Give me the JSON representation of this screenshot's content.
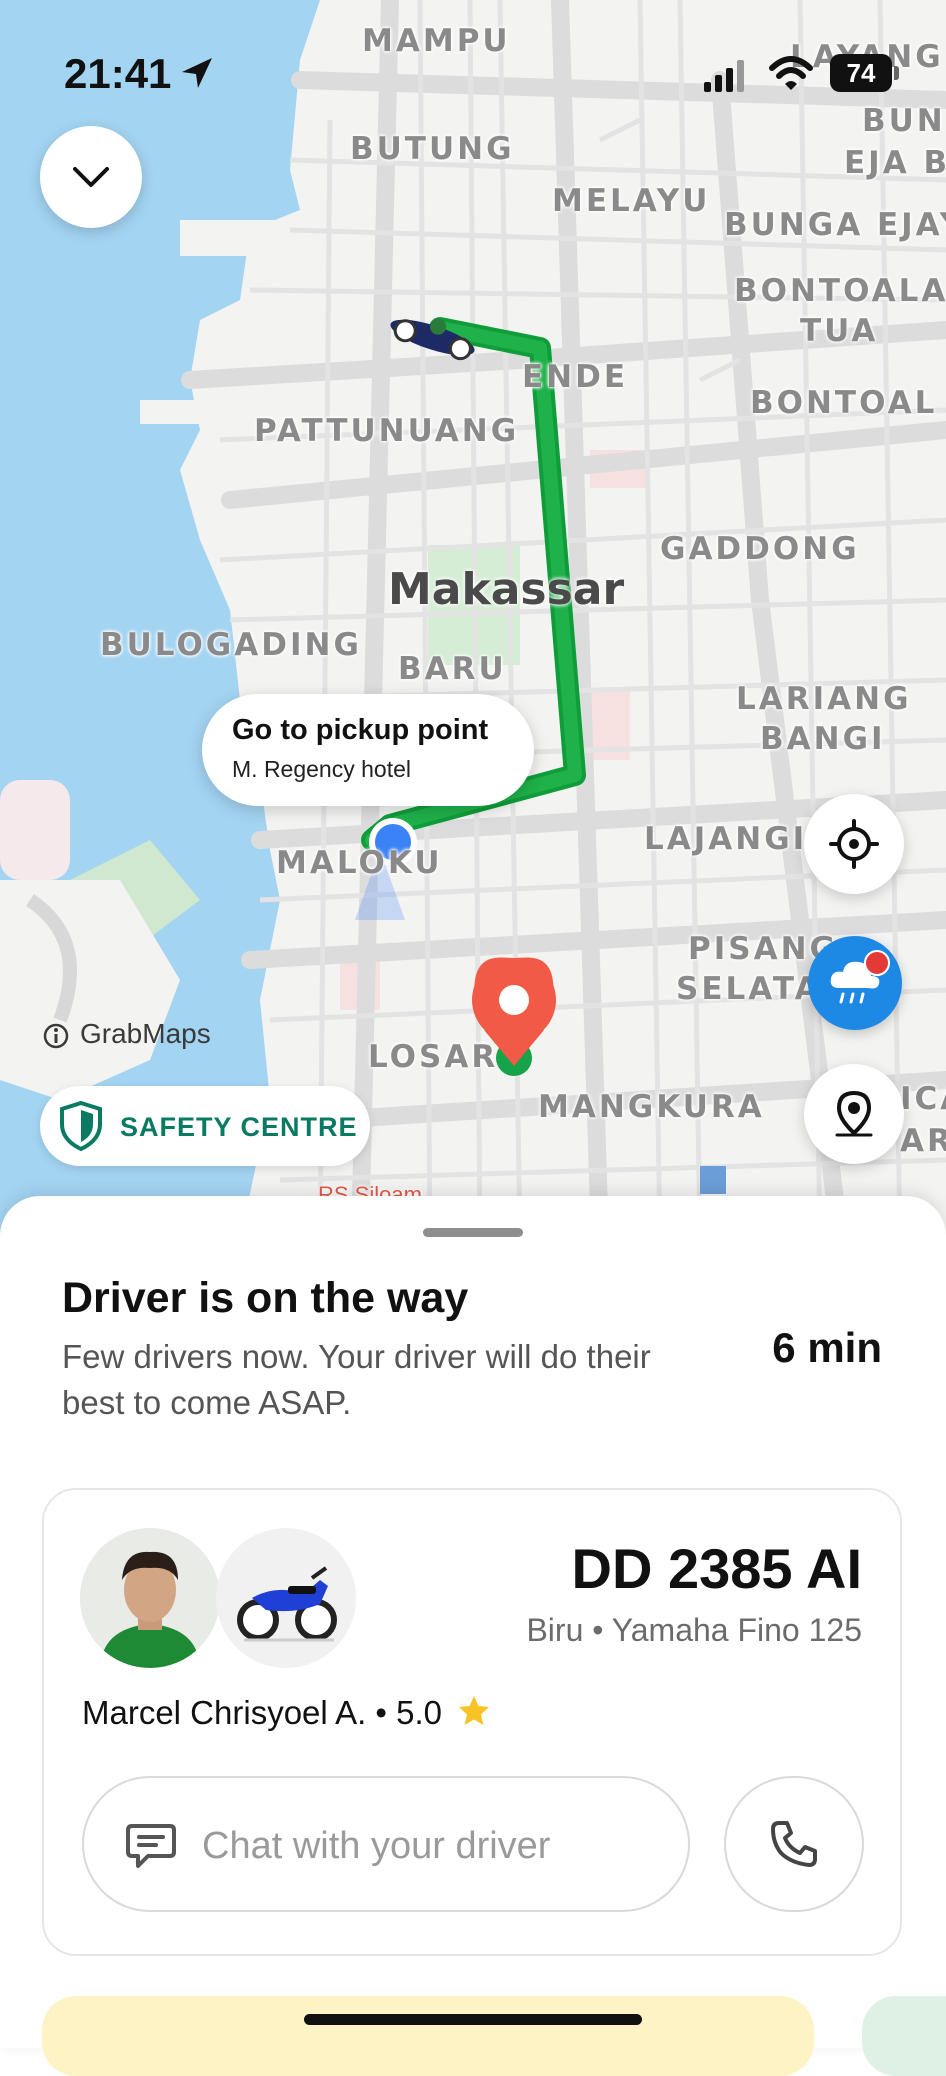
{
  "status_bar": {
    "time": "21:41",
    "battery": "74"
  },
  "map": {
    "attribution": "GrabMaps",
    "city": "Makassar",
    "labels": {
      "mampu": "MAMPU",
      "butung": "BUTUNG",
      "melayu": "MELAYU",
      "layang": "LAYANG",
      "bun": "BUN",
      "eja_b": "EJA B",
      "bunga_ejay": "BUNGA EJAY",
      "bontoala": "BONTOALA",
      "tua": "TUA",
      "bontoala2": "BONTOAL",
      "ende": "ENDE",
      "pattunuang": "PATTUNUANG",
      "gaddong": "GADDONG",
      "bulogading": "BULOGADING",
      "baru": "BARU",
      "lariang": "LARIANG",
      "bangi": "BANGI",
      "lajangi": "LAJANGI",
      "maloku": "MALOKU",
      "pisang": "PISANG",
      "selatan": "SELATA",
      "losari": "LOSAR",
      "mangkura": "MANGKURA",
      "ica": "ICA",
      "aru": "ARU",
      "rs_siloam": "RS Siloam"
    },
    "callout": {
      "title": "Go to pickup point",
      "subtitle": "M. Regency hotel"
    },
    "safety_label": "SAFETY CENTRE"
  },
  "sheet": {
    "title": "Driver is on the way",
    "subtitle": "Few drivers now. Your driver will do their best to come ASAP.",
    "eta": "6 min",
    "plate": "DD 2385 AI",
    "vehicle": "Biru • Yamaha Fino 125",
    "driver": "Marcel Chrisyoel A. • 5.0",
    "chat_placeholder": "Chat with your driver"
  },
  "colors": {
    "route": "#16a34a",
    "pin": "#f05a46",
    "user_dot": "#3b82f6",
    "weather": "#1e88e5",
    "safety": "#0a7a63",
    "water": "#9fd1f0"
  },
  "icons": [
    "location-arrow-icon",
    "signal-icon",
    "wifi-icon",
    "battery-icon",
    "chevron-down-icon",
    "crosshair-icon",
    "rain-cloud-icon",
    "location-pin-icon",
    "shield-icon",
    "info-icon",
    "chat-bubble-icon",
    "phone-icon",
    "star-icon",
    "motorbike-icon"
  ]
}
